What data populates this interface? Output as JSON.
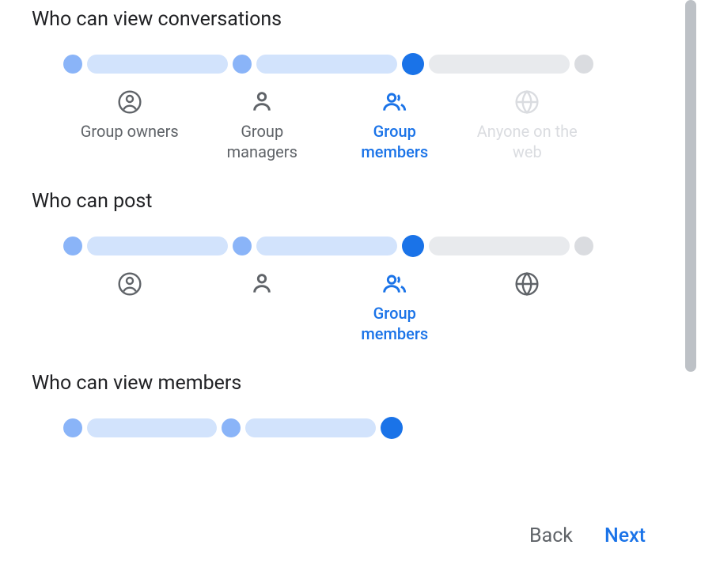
{
  "sections": [
    {
      "title": "Who can view conversations",
      "options": [
        {
          "label": "Group owners",
          "state": "normal"
        },
        {
          "label": "Group managers",
          "state": "normal"
        },
        {
          "label": "Group members",
          "state": "selected"
        },
        {
          "label": "Anyone on the web",
          "state": "disabled"
        }
      ]
    },
    {
      "title": "Who can post",
      "options": [
        {
          "label": "",
          "state": "normal"
        },
        {
          "label": "",
          "state": "normal"
        },
        {
          "label": "Group members",
          "state": "selected"
        },
        {
          "label": "",
          "state": "normal"
        }
      ]
    },
    {
      "title": "Who can view members",
      "selected_index": 2
    }
  ],
  "buttons": {
    "back": "Back",
    "next": "Next"
  }
}
